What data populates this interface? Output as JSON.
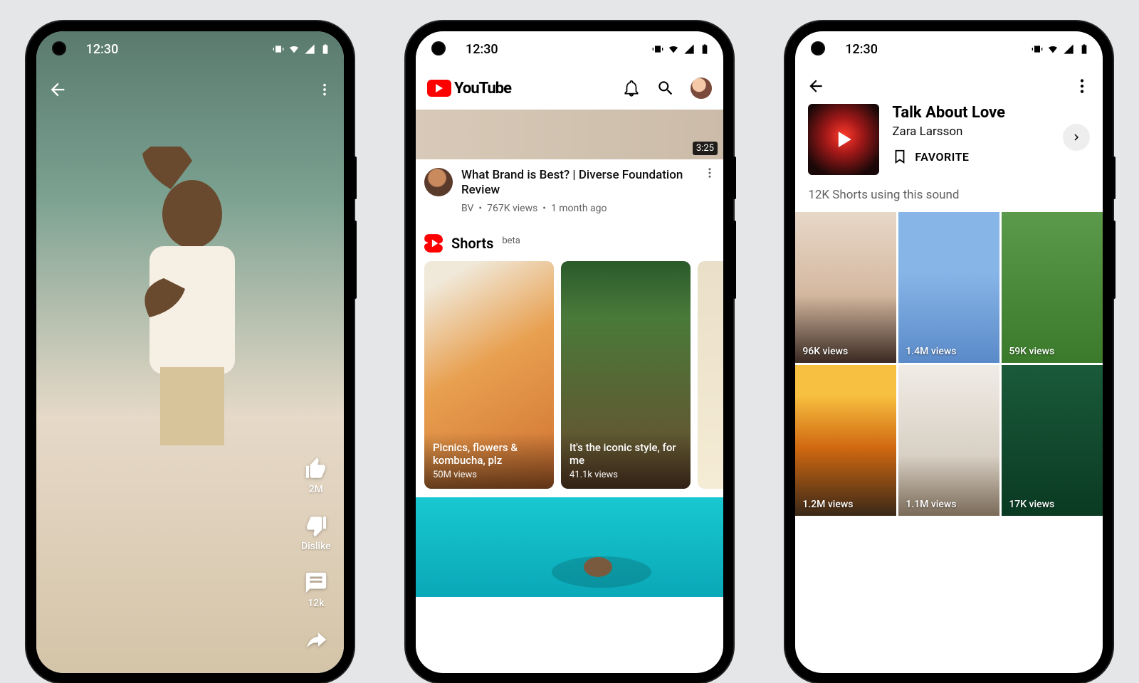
{
  "status_time": "12:30",
  "phone1": {
    "like_count": "2M",
    "dislike_label": "Dislike",
    "comment_count": "12k"
  },
  "phone2": {
    "brand": "YouTube",
    "video": {
      "duration": "3:25",
      "title": "What Brand is Best? | Diverse Foundation Review",
      "channel": "BV",
      "views": "767K views",
      "age": "1 month ago"
    },
    "shorts_header": "Shorts",
    "shorts_badge": "beta",
    "shorts": [
      {
        "title": "Picnics, flowers & kombucha, plz",
        "views": "50M views"
      },
      {
        "title": "It's the iconic style, for me",
        "views": "41.1k views"
      }
    ]
  },
  "phone3": {
    "title": "Talk About Love",
    "artist": "Zara Larsson",
    "favorite_label": "FAVORITE",
    "count_text": "12K Shorts using this sound",
    "grid": [
      {
        "views": "96K views"
      },
      {
        "views": "1.4M views"
      },
      {
        "views": "59K views"
      },
      {
        "views": "1.2M views"
      },
      {
        "views": "1.1M views"
      },
      {
        "views": "17K views"
      }
    ]
  }
}
